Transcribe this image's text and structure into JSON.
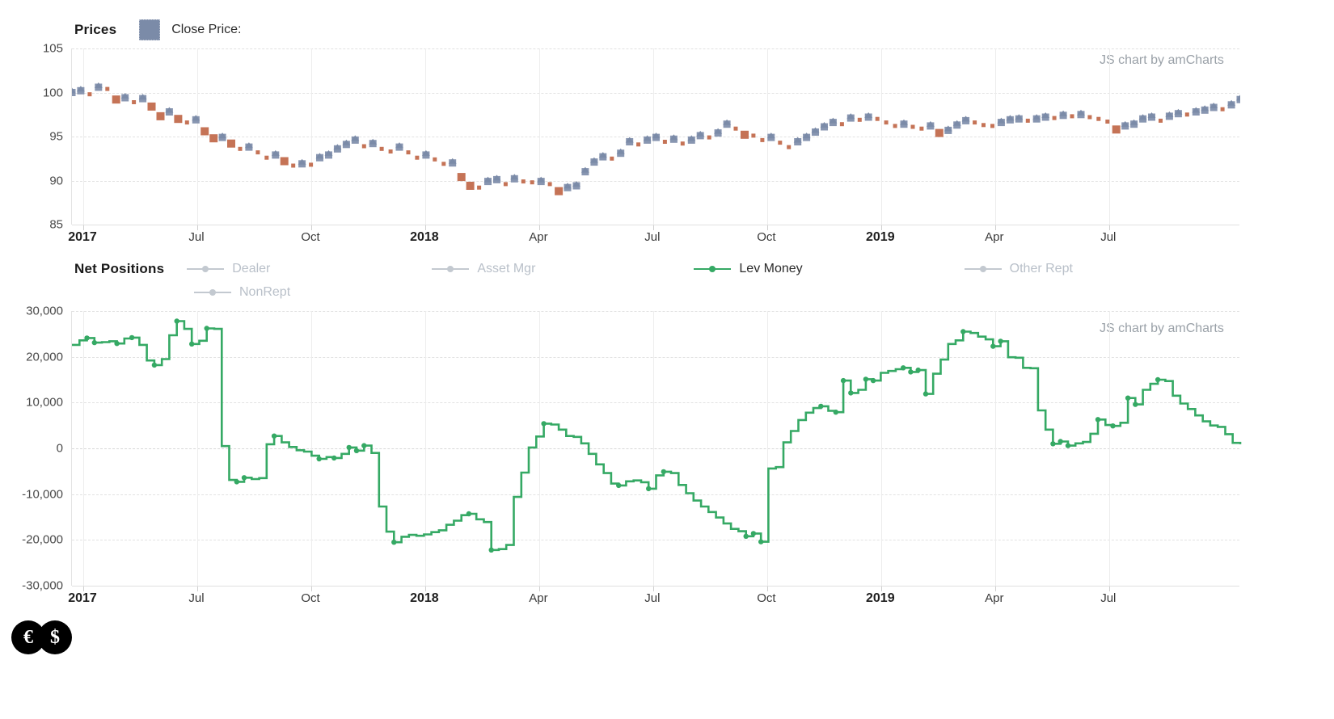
{
  "prices_panel": {
    "legend_title": "Prices",
    "series_label": "Close Price:",
    "swatch_color": "#7b8ba8",
    "watermark": "JS chart by amCharts",
    "y_ticks": [
      "105",
      "100",
      "95",
      "90",
      "85"
    ],
    "x_ticks": [
      "2017",
      "Jul",
      "Oct",
      "2018",
      "Apr",
      "Jul",
      "Oct",
      "2019",
      "Apr",
      "Jul"
    ]
  },
  "positions_panel": {
    "legend_title": "Net Positions",
    "watermark": "JS chart by amCharts",
    "legend_items": [
      {
        "label": "Dealer",
        "color": "#c3c9d0",
        "active": false
      },
      {
        "label": "Asset Mgr",
        "color": "#c3c9d0",
        "active": false
      },
      {
        "label": "Lev Money",
        "color": "#35a964",
        "active": true
      },
      {
        "label": "Other Rept",
        "color": "#c3c9d0",
        "active": false
      },
      {
        "label": "NonRept",
        "color": "#c3c9d0",
        "active": false
      }
    ],
    "y_ticks": [
      "30,000",
      "20,000",
      "10,000",
      "0",
      "-10,000",
      "-20,000",
      "-30,000"
    ],
    "x_ticks": [
      "2017",
      "Jul",
      "Oct",
      "2018",
      "Apr",
      "Jul",
      "Oct",
      "2019",
      "Apr",
      "Jul"
    ]
  },
  "footer": {
    "logos": [
      "€",
      "$"
    ]
  },
  "chart_data": [
    {
      "type": "scatter",
      "title": "Prices",
      "xlabel": "",
      "ylabel": "",
      "ylim": [
        85,
        105
      ],
      "yticks": [
        85,
        90,
        95,
        100,
        105
      ],
      "xticks": [
        "2017",
        "Jul",
        "Oct",
        "2018",
        "Apr",
        "Jul",
        "Oct",
        "2019",
        "Apr",
        "Jul"
      ],
      "grid": true,
      "legend": "top-left",
      "series": [
        {
          "name": "Close Price",
          "marker": "candle",
          "colors": {
            "up": "#7b8ba8",
            "down": "#c26b4d"
          },
          "values": [
            100.0,
            100.2,
            99.8,
            100.6,
            100.4,
            99.2,
            99.4,
            98.9,
            99.3,
            98.4,
            97.3,
            97.8,
            97.0,
            96.6,
            96.9,
            95.6,
            94.8,
            94.9,
            94.2,
            93.6,
            93.8,
            93.2,
            92.6,
            92.9,
            92.2,
            91.7,
            91.9,
            91.8,
            92.6,
            92.9,
            93.6,
            94.1,
            94.6,
            93.9,
            94.2,
            93.6,
            93.3,
            93.8,
            93.2,
            92.6,
            92.9,
            92.4,
            91.9,
            92.0,
            90.4,
            89.4,
            89.2,
            89.9,
            90.1,
            89.6,
            90.2,
            89.9,
            89.8,
            89.9,
            89.6,
            88.8,
            89.2,
            89.4,
            91.0,
            92.1,
            92.7,
            92.5,
            93.1,
            94.4,
            94.1,
            94.6,
            94.9,
            94.4,
            94.7,
            94.2,
            94.6,
            95.1,
            94.9,
            95.4,
            96.4,
            95.9,
            95.2,
            95.1,
            94.6,
            94.9,
            94.3,
            93.8,
            94.4,
            94.9,
            95.5,
            96.1,
            96.6,
            96.4,
            97.1,
            96.9,
            97.2,
            97.0,
            96.6,
            96.2,
            96.4,
            96.1,
            95.9,
            96.2,
            95.4,
            95.7,
            96.3,
            96.8,
            96.6,
            96.3,
            96.2,
            96.6,
            96.9,
            97.0,
            96.8,
            97.0,
            97.2,
            97.1,
            97.4,
            97.3,
            97.5,
            97.2,
            97.0,
            96.7,
            95.8,
            96.2,
            96.4,
            97.0,
            97.2,
            96.8,
            97.3,
            97.6,
            97.5,
            97.8,
            98.0,
            98.3,
            98.1,
            98.6,
            99.2
          ]
        }
      ]
    },
    {
      "type": "line",
      "title": "Net Positions",
      "xlabel": "",
      "ylabel": "",
      "ylim": [
        -30000,
        30000
      ],
      "yticks": [
        -30000,
        -20000,
        -10000,
        0,
        10000,
        20000,
        30000
      ],
      "xticks": [
        "2017",
        "Jul",
        "Oct",
        "2018",
        "Apr",
        "Jul",
        "Oct",
        "2019",
        "Apr",
        "Jul"
      ],
      "grid": true,
      "legend": "top",
      "step": true,
      "series": [
        {
          "name": "Lev Money",
          "color": "#35a964",
          "visible": true,
          "values": [
            22600,
            23600,
            24100,
            23100,
            23200,
            23400,
            22900,
            24000,
            24200,
            22600,
            19200,
            18200,
            19500,
            24700,
            27800,
            26100,
            22800,
            23500,
            26200,
            26100,
            500,
            -6900,
            -7300,
            -6400,
            -6700,
            -6500,
            900,
            2700,
            1300,
            300,
            -400,
            -700,
            -1600,
            -2300,
            -1900,
            -2100,
            -1200,
            200,
            -500,
            600,
            -1000,
            -12700,
            -18200,
            -20500,
            -19300,
            -18900,
            -19100,
            -18800,
            -18300,
            -17900,
            -16700,
            -15800,
            -14600,
            -14300,
            -15500,
            -16100,
            -22200,
            -22000,
            -21100,
            -10600,
            -5300,
            200,
            2600,
            5400,
            5200,
            4100,
            2700,
            2500,
            1100,
            -1200,
            -3500,
            -5400,
            -7700,
            -8100,
            -7200,
            -7000,
            -7400,
            -8800,
            -5900,
            -5100,
            -5400,
            -8000,
            -9800,
            -11400,
            -12700,
            -13900,
            -15100,
            -16400,
            -17600,
            -18100,
            -19200,
            -18600,
            -20400,
            -4400,
            -4100,
            1300,
            3800,
            6200,
            7800,
            8800,
            9200,
            8200,
            7900,
            14800,
            12100,
            12800,
            15100,
            14800,
            16500,
            16900,
            17300,
            17600,
            16700,
            17100,
            11900,
            16300,
            19400,
            22800,
            23600,
            25500,
            25200,
            24400,
            23800,
            22300,
            23400,
            19900,
            19800,
            17600,
            17500,
            8300,
            4100,
            1000,
            1500,
            600,
            1100,
            1400,
            3200,
            6300,
            5100,
            4900,
            5600,
            11000,
            9600,
            12800,
            14100,
            15000,
            14700,
            11500,
            9800,
            8600,
            7200,
            5900,
            5000,
            4700,
            3100,
            1200,
            900
          ]
        }
      ]
    }
  ]
}
